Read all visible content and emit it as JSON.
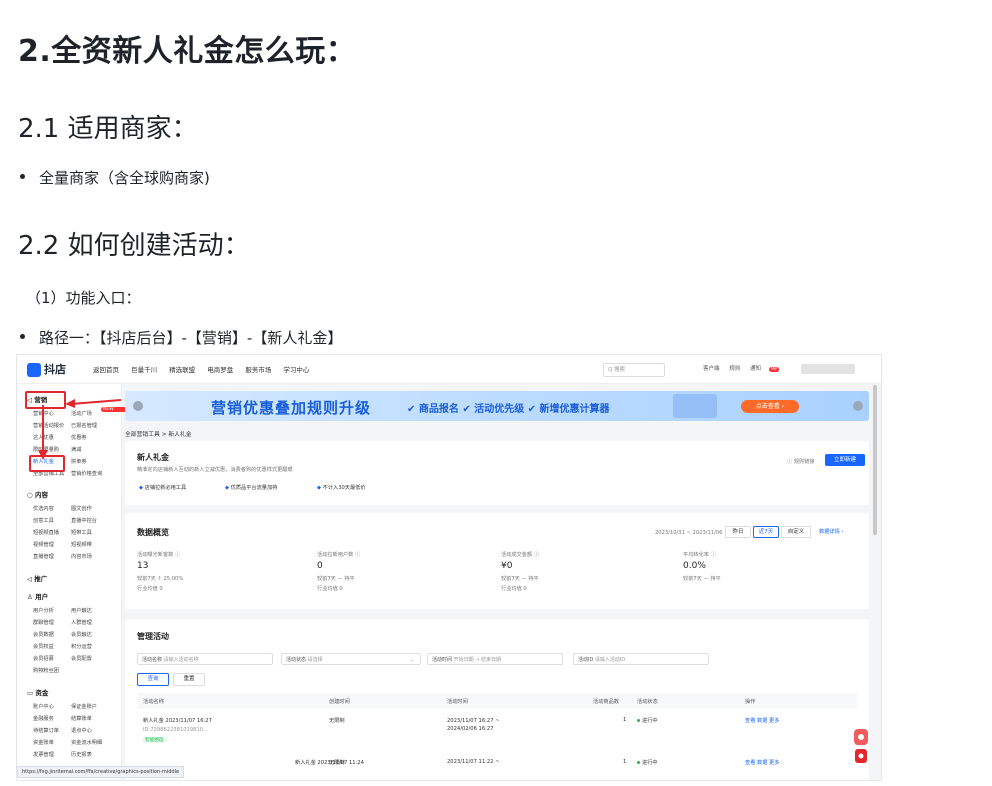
{
  "doc": {
    "h1": "2.全资新人礼金怎么玩：",
    "h2_1": "2.1 适用商家：",
    "bullet_1": "全量商家（含全球购商家)",
    "h2_2": "2.2 如何创建活动：",
    "para_1": "（1）功能入口：",
    "bullet_2": "路径一：【抖店后台】-【营销】-【新人礼金】"
  },
  "shot": {
    "logo": "抖店",
    "topnav": [
      "返回首页",
      "巨量千川",
      "精选联盟",
      "电商罗盘",
      "服务市场",
      "学习中心"
    ],
    "search_placeholder": "Q 搜索",
    "top_right": [
      "客户端",
      "规则",
      "通知"
    ],
    "notify_badge": "99",
    "sidebar": {
      "group_marketing": "营销",
      "rows_marketing": [
        [
          "营销中心",
          "活动广场"
        ],
        [
          "营销活动报价",
          "已报名管理"
        ],
        [
          "达人优惠",
          "优惠券"
        ],
        [
          "限时限量购",
          "满减"
        ],
        [
          "新人礼金",
          "拼单券"
        ],
        [
          "全部营销工具",
          "营销价格查询"
        ]
      ],
      "new_badge": "NEW",
      "group_content": "内容",
      "rows_content": [
        [
          "优选内容",
          "图文创作"
        ],
        [
          "创意工具",
          "直播中控台"
        ],
        [
          "短视频直播",
          "短带工具"
        ],
        [
          "视频管理",
          "短视频带"
        ],
        [
          "直播管理",
          "内容市场"
        ]
      ],
      "group_promo": "推广",
      "group_user": "用户",
      "rows_user": [
        [
          "用户分析",
          "用户触达"
        ],
        [
          "群聊管理",
          "人群管理"
        ],
        [
          "会员数据",
          "会员触达"
        ],
        [
          "会员权益",
          "积分运营"
        ],
        [
          "会员招募",
          "会员配置"
        ],
        [
          "购物粉丝团",
          ""
        ]
      ],
      "group_fund": "资金",
      "rows_fund": [
        [
          "账户中心",
          "保证金账户"
        ],
        [
          "金融服务",
          "结算账单"
        ],
        [
          "待结算订单",
          "退点中心"
        ],
        [
          "资金账单",
          "资金流水明细"
        ],
        [
          "发票管理",
          "历史报表"
        ]
      ]
    },
    "banner": {
      "title": "营销优惠叠加规则升级",
      "items": "✔ 商品报名 ✔ 活动优先级 ✔ 新增优惠计算器",
      "button": "点击查看 ›"
    },
    "breadcrumb": "全部营销工具 > 新人礼金",
    "intro": {
      "title": "新人礼金",
      "desc": "精准定向店铺新人互动的新人立减优惠，消费者购的优惠样式更醒眼",
      "features": [
        "店铺拉新必用工具",
        "优质品平台流量加持",
        "不计入30天最低价"
      ],
      "rule_link": "ⓘ 规则链接",
      "create_button": "立即新建"
    },
    "overview": {
      "title": "数据概览",
      "date_range": "2023/10/31 ~ 2023/11/06",
      "ranges": [
        "昨日",
        "近7天",
        "自定义"
      ],
      "detail_link": "数据详情 ›",
      "metrics": [
        {
          "label": "活动曝光新客数 ⓘ",
          "value": "13",
          "compare": "较前7天 ↑ 25.00%",
          "peer": "行业均值 0"
        },
        {
          "label": "活动拉新用户数 ⓘ",
          "value": "0",
          "compare": "较前7天 — 持平",
          "peer": "行业均值 0"
        },
        {
          "label": "活动成交金额 ⓘ",
          "value": "¥0",
          "compare": "较前7天 — 持平",
          "peer": "行业均值 0"
        },
        {
          "label": "平均转化率 ⓘ",
          "value": "0.0%",
          "compare": "较前7天 — 持平",
          "peer": ""
        }
      ]
    },
    "manage": {
      "title": "管理活动",
      "filters": [
        {
          "label": "活动名称",
          "placeholder": "请输入活动名称"
        },
        {
          "label": "活动状态",
          "placeholder": "请选择"
        },
        {
          "label": "活动时间",
          "placeholder": "开始日期  →  结束日期"
        },
        {
          "label": "活动ID",
          "placeholder": "请输入活动ID"
        }
      ],
      "query_button": "查询",
      "reset_button": "重置",
      "columns": [
        "活动名称",
        "创建时间",
        "活动时间",
        "活动商品数",
        "活动状态",
        "操作"
      ],
      "rows": [
        {
          "name": "新人礼金 2023/11/07 16:27",
          "id": "ID:7298622381019810...",
          "tag": "智能圈选",
          "created": "无限制",
          "time": "2023/11/07 16:27 ~ 2024/02/06 16:27",
          "count": "1",
          "status": "进行中",
          "ops": "查看  数据  更多"
        },
        {
          "name": "新人礼金 2023/11/07 11:24",
          "created": "无限制",
          "time": "2023/11/07 11:22 ~",
          "count": "1",
          "status": "进行中",
          "ops": "查看  数据  更多"
        }
      ]
    },
    "status_url": "https://fxg.jinritemai.com/ffa/creative/graphics-position-middle"
  }
}
